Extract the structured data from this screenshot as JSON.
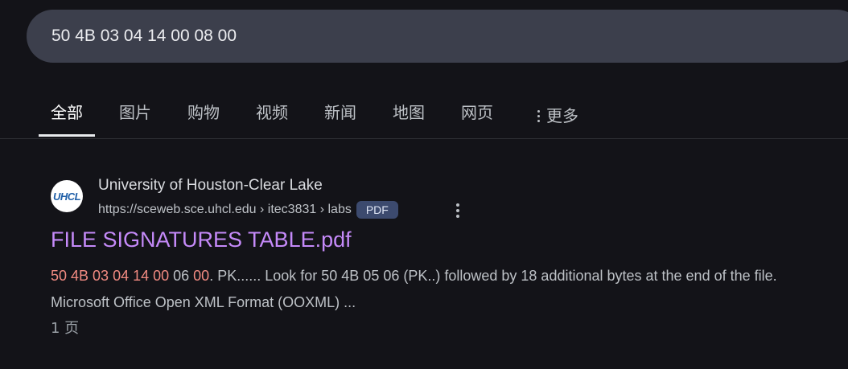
{
  "search": {
    "query": "50 4B 03 04 14 00 08 00"
  },
  "tabs": [
    {
      "label": "全部",
      "active": true
    },
    {
      "label": "图片"
    },
    {
      "label": "购物"
    },
    {
      "label": "视频"
    },
    {
      "label": "新闻"
    },
    {
      "label": "地图"
    },
    {
      "label": "网页"
    }
  ],
  "more_tab": {
    "label": "更多"
  },
  "result": {
    "favicon_text": "UHCL",
    "site_name": "University of Houston-Clear Lake",
    "url": "https://sceweb.sce.uhcl.edu › itec3831 › labs",
    "badge": "PDF",
    "title": "FILE SIGNATURES TABLE.pdf",
    "snippet": {
      "h1": "50 4B 03 04 14 00",
      "t1": " 06 ",
      "h2": "00",
      "t2": ". PK...... Look for 50 4B 05 06 (PK..) followed by 18 additional bytes at the end of the file. Microsoft Office Open XML Format (OOXML) ..."
    },
    "page_count": "1 页"
  },
  "colors": {
    "background": "#131318",
    "search_bar": "#3c3f4c",
    "link": "#c58af9",
    "highlight": "#f28b82",
    "badge": "#3c4a6e"
  }
}
